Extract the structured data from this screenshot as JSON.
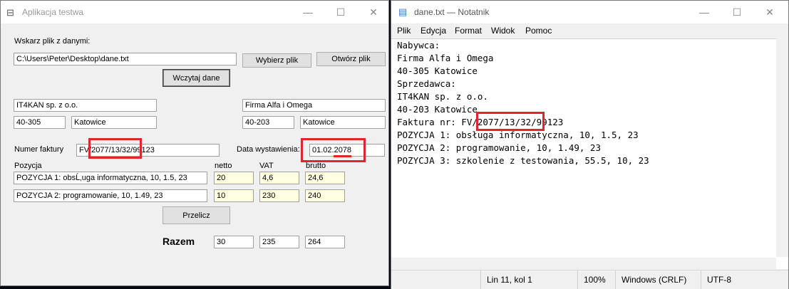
{
  "app": {
    "title": "Aplikacja testwa",
    "choose_file_label": "Wskarz plik z danymi:",
    "file_path": "C:\\Users\\Peter\\Desktop\\dane.txt",
    "choose_file_button": "Wybierz plik",
    "open_file_button": "Otwórz plik",
    "load_button": "Wczytaj dane",
    "seller": {
      "name": "IT4KAN sp. z o.o.",
      "postal": "40-305",
      "city": "Katowice"
    },
    "buyer": {
      "name": "Firma Alfa i Omega",
      "postal": "40-203",
      "city": "Katowice"
    },
    "invoice_label": "Numer faktury",
    "invoice_number": "FV/2077/13/32/99123",
    "date_label": "Data wystawienia:",
    "date_value": "01.02.2078",
    "headers": {
      "item": "Pozycja",
      "net": "netto",
      "vat": "VAT",
      "gross": "brutto"
    },
    "items": [
      {
        "desc": "POZYCJA 1: obsĹ‚uga informatyczna, 10, 1.5, 23",
        "net": "20",
        "vat": "4,6",
        "gross": "24,6"
      },
      {
        "desc": "POZYCJA 2: programowanie, 10, 1.49, 23",
        "net": "10",
        "vat": "230",
        "gross": "240"
      }
    ],
    "recalc_button": "Przelicz",
    "total_label": "Razem",
    "totals": {
      "net": "30",
      "vat": "235",
      "gross": "264"
    }
  },
  "notepad": {
    "title": "dane.txt — Notatnik",
    "menu": [
      "Plik",
      "Edycja",
      "Format",
      "Widok",
      "Pomoc"
    ],
    "lines": [
      "Nabywca:",
      "Firma Alfa i Omega",
      "40-305 Katowice",
      "Sprzedawca:",
      "IT4KAN sp. z o.o.",
      "40-203 Katowice",
      "Faktura nr: FV/2077/13/32/99123",
      "POZYCJA 1: obsługa informatyczna, 10, 1.5, 23",
      "POZYCJA 2: programowanie, 10, 1.49, 23",
      "POZYCJA 3: szkolenie z testowania, 55.5, 10, 23"
    ],
    "status": {
      "position": "Lin 11, kol 1",
      "zoom": "100%",
      "eol": "Windows (CRLF)",
      "encoding": "UTF-8"
    }
  },
  "colors": {
    "highlight": "#e0262c",
    "yellow_field": "#ffffe1"
  }
}
